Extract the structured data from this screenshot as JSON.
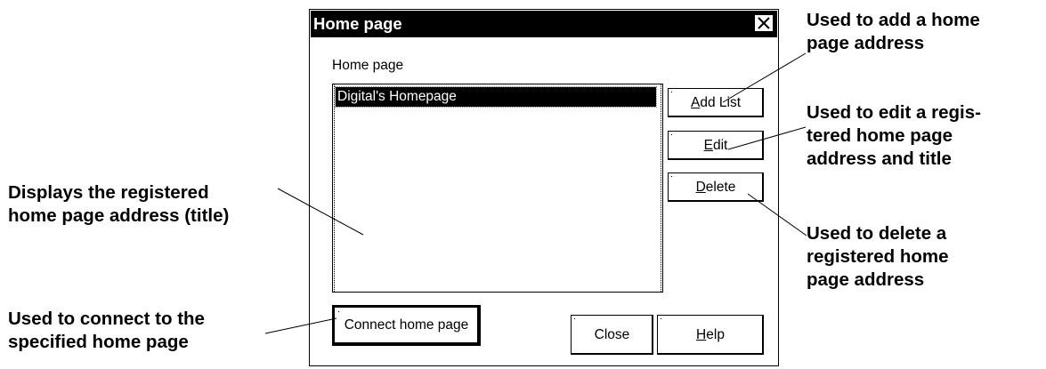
{
  "dialog": {
    "title": "Home page",
    "close_glyph": "X",
    "group_label": "Home page",
    "list_items": [
      "Digital's Homepage"
    ],
    "buttons": {
      "add_list": {
        "accel": "A",
        "rest": "dd List"
      },
      "edit": {
        "accel": "E",
        "rest": "dit"
      },
      "delete": {
        "accel": "D",
        "rest": "elete"
      },
      "connect": "Connect home page",
      "close": "Close",
      "help": {
        "accel": "H",
        "rest": "elp"
      }
    }
  },
  "callouts": {
    "add_list": "Used to add a home\npage address",
    "edit": "Used to edit a regis-\ntered home page\naddress and title",
    "delete": "Used to delete a\nregistered home\npage address",
    "listbox": "Displays the registered\nhome page address (title)",
    "connect": "Used to connect to the\nspecified home page"
  },
  "colors": {
    "titlebar": "#000000",
    "selection": "#000000",
    "background": "#ffffff"
  }
}
